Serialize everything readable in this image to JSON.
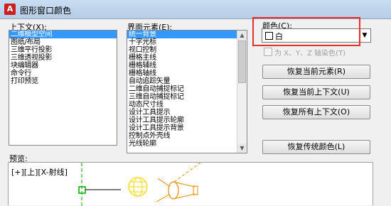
{
  "window": {
    "title": "图形窗口颜色"
  },
  "context": {
    "label": "上下文(X):",
    "items": [
      "二维模型空间",
      "图纸/布局",
      "三维平行投影",
      "三维透视投影",
      "块编辑器",
      "命令行",
      "打印预览"
    ],
    "selected_index": 0
  },
  "elements": {
    "label": "界面元素(E):",
    "items": [
      "统一背景",
      "十字光标",
      "视口控制",
      "栅格主线",
      "栅格辅线",
      "栅格轴线",
      "自动追踪矢量",
      "二维自动捕捉标记",
      "三维自动捕捉标记",
      "动态尺寸线",
      "设计工具提示",
      "设计工具提示轮廓",
      "设计工具提示背景",
      "控制点外壳线",
      "光线轮廓"
    ],
    "selected_index": 0
  },
  "color": {
    "label": "颜色(C):",
    "value": "白",
    "swatch": "#ffffff"
  },
  "tint": {
    "label": "为 X、Y、Z 轴染色(T)",
    "checked": false
  },
  "buttons": {
    "restore_element": "恢复当前元素(R)",
    "restore_context": "恢复当前上下文(U)",
    "restore_all": "恢复所有上下文(O)",
    "restore_classic": "恢复传统颜色(L)"
  },
  "preview": {
    "label": "预览:",
    "viewport_label": "[+][上][X-射线]"
  },
  "colors": {
    "selection": "#3399ff",
    "highlight": "#e8302a",
    "axis_green": "#00aa00",
    "light_yellow": "#ffd700",
    "light_orange": "#e88a00"
  }
}
